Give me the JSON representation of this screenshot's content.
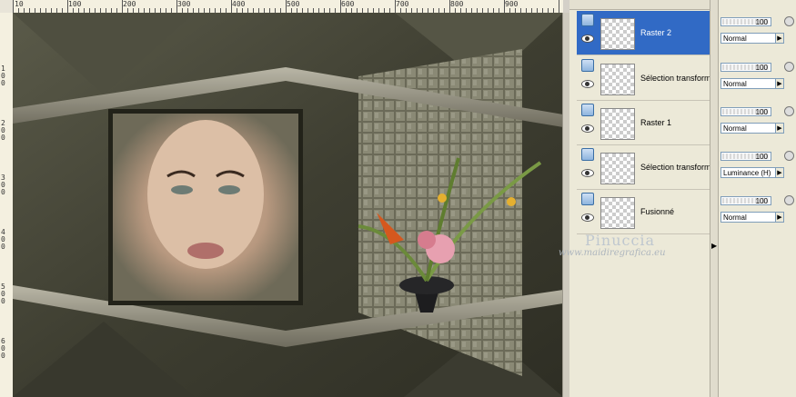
{
  "ruler": {
    "h_labels": [
      "10",
      "100",
      "200",
      "300",
      "400",
      "500",
      "600",
      "700",
      "800",
      "900"
    ],
    "v_labels": [
      "1\n0\n0",
      "2\n0\n0",
      "3\n0\n0",
      "4\n0\n0",
      "5\n0\n0",
      "6\n0\n0"
    ]
  },
  "canvas": {
    "image_name": "portrait-collage-artwork"
  },
  "watermark": {
    "title": "Pinuccia",
    "url": "www.maidiregrafica.eu"
  },
  "layers": [
    {
      "name": "Raster 2",
      "opacity": "100",
      "blend": "Normal",
      "selected": true
    },
    {
      "name": "Sélection transform",
      "opacity": "100",
      "blend": "Normal",
      "selected": false
    },
    {
      "name": "Raster 1",
      "opacity": "100",
      "blend": "Normal",
      "selected": false
    },
    {
      "name": "Sélection transform",
      "opacity": "100",
      "blend": "Luminance (H)",
      "selected": false
    },
    {
      "name": "Fusionné",
      "opacity": "100",
      "blend": "Normal",
      "selected": false
    }
  ],
  "colors": {
    "selection": "#316ac5",
    "panel_bg": "#ece9d8"
  }
}
